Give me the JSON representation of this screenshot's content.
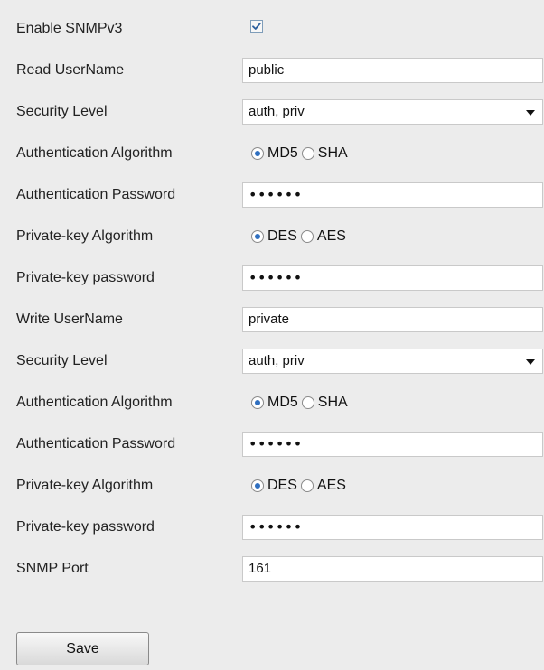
{
  "form": {
    "rows": [
      {
        "label": "Enable SNMPv3",
        "type": "checkbox",
        "checked": true
      },
      {
        "label": "Read UserName",
        "type": "text",
        "value": "public"
      },
      {
        "label": "Security Level",
        "type": "select",
        "value": "auth, priv"
      },
      {
        "label": "Authentication Algorithm",
        "type": "radio",
        "options": [
          "MD5",
          "SHA"
        ],
        "selected": "MD5"
      },
      {
        "label": "Authentication Password",
        "type": "password",
        "value": "••••••"
      },
      {
        "label": "Private-key Algorithm",
        "type": "radio",
        "options": [
          "DES",
          "AES"
        ],
        "selected": "DES"
      },
      {
        "label": "Private-key password",
        "type": "password",
        "value": "••••••"
      },
      {
        "label": "Write UserName",
        "type": "text",
        "value": "private"
      },
      {
        "label": "Security Level",
        "type": "select",
        "value": "auth, priv"
      },
      {
        "label": "Authentication Algorithm",
        "type": "radio",
        "options": [
          "MD5",
          "SHA"
        ],
        "selected": "MD5"
      },
      {
        "label": "Authentication Password",
        "type": "password",
        "value": "••••••"
      },
      {
        "label": "Private-key Algorithm",
        "type": "radio",
        "options": [
          "DES",
          "AES"
        ],
        "selected": "DES"
      },
      {
        "label": "Private-key password",
        "type": "password",
        "value": "••••••"
      },
      {
        "label": "SNMP Port",
        "type": "text",
        "value": "161"
      }
    ],
    "save_label": "Save"
  },
  "colors": {
    "panel_background": "#ececec",
    "field_border": "#c9c9c9",
    "radio_selected": "#2f6fc0",
    "checkbox_border": "#7f9db9",
    "checkbox_tick": "#2b5f9e"
  },
  "icons": {
    "checkbox": "checkmark-icon",
    "select": "chevron-down-icon"
  }
}
